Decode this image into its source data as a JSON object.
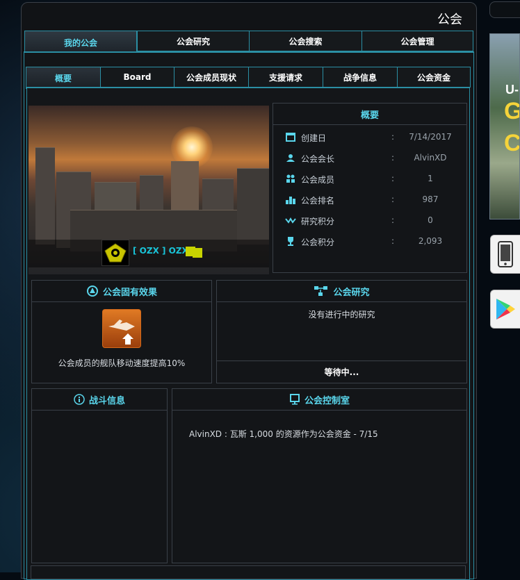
{
  "window": {
    "title": "公会"
  },
  "top_tabs": [
    {
      "label": "我的公会"
    },
    {
      "label": "公会研究"
    },
    {
      "label": "公会搜索"
    },
    {
      "label": "公会管理"
    }
  ],
  "sub_tabs": [
    {
      "label": "概要"
    },
    {
      "label": "Board"
    },
    {
      "label": "公会成员现状"
    },
    {
      "label": "支援请求"
    },
    {
      "label": "战争信息"
    },
    {
      "label": "公会资金"
    }
  ],
  "guild": {
    "name": "[ OZX ] OZX",
    "color": "#c8d400"
  },
  "overview": {
    "title": "概要",
    "rows": [
      {
        "label": "创建日",
        "value": "7/14/2017",
        "icon": "calendar-icon"
      },
      {
        "label": "公会会长",
        "value": "AlvinXD",
        "icon": "leader-icon"
      },
      {
        "label": "公会成员",
        "value": "1",
        "icon": "members-icon"
      },
      {
        "label": "公会排名",
        "value": "987",
        "icon": "ranking-icon"
      },
      {
        "label": "研究积分",
        "value": "0",
        "icon": "research-points-icon"
      },
      {
        "label": "公会积分",
        "value": "2,093",
        "icon": "trophy-icon"
      }
    ],
    "separator": ":"
  },
  "effects": {
    "title": "公会固有效果",
    "description": "公会成员的舰队移动速度提高10%"
  },
  "research": {
    "title": "公会研究",
    "status": "没有进行中的研究",
    "waiting": "等待中..."
  },
  "battle": {
    "title": "战斗信息"
  },
  "control": {
    "title": "公会控制室",
    "log": "AlvinXD : 瓦斯 1,000 的资源作为公会资金 - 7/15"
  },
  "banner": {
    "text_line1": "U-",
    "text_line2": "G",
    "text_line3": "C"
  },
  "colors": {
    "accent": "#5ad6ec",
    "frame": "#2b8fa4",
    "panel": "#131518"
  }
}
